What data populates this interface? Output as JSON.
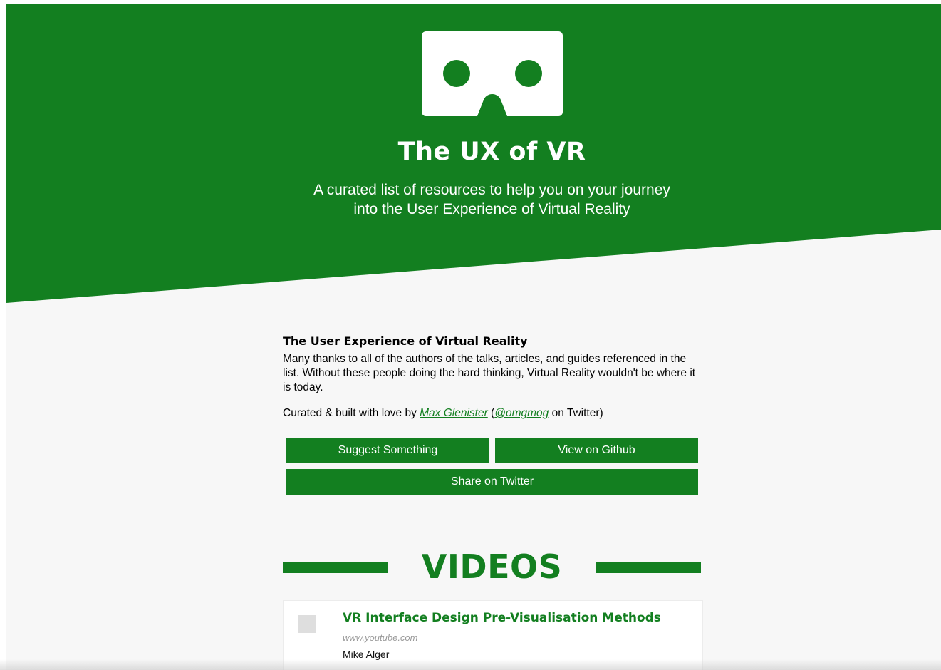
{
  "hero": {
    "title": "The UX of VR",
    "subtitle_line1": "A curated list of resources to help you on your journey",
    "subtitle_line2": "into the User Experience of Virtual Reality",
    "logo_icon": "vr-headset-icon",
    "background_color": "#137f20"
  },
  "intro": {
    "heading": "The User Experience of Virtual Reality",
    "thanks": "Many thanks to all of the authors of the talks, articles, and guides referenced in the list. Without these people doing the hard thinking, Virtual Reality wouldn't be where it is today.",
    "credit_prefix": "Curated & built with love by ",
    "author_link": "Max Glenister",
    "paren_open": " (",
    "twitter_handle": "@omgmog",
    "credit_suffix": " on Twitter)"
  },
  "buttons": {
    "suggest": "Suggest Something",
    "github": "View on Github",
    "twitter": "Share on Twitter"
  },
  "section": {
    "title": "VIDEOS"
  },
  "videos": [
    {
      "title": "VR Interface Design Pre-Visualisation Methods",
      "source": "www.youtube.com",
      "author": "Mike Alger"
    }
  ],
  "colors": {
    "accent": "#137f20",
    "background": "#f7f7f7",
    "muted_text": "#9a9a9a"
  }
}
